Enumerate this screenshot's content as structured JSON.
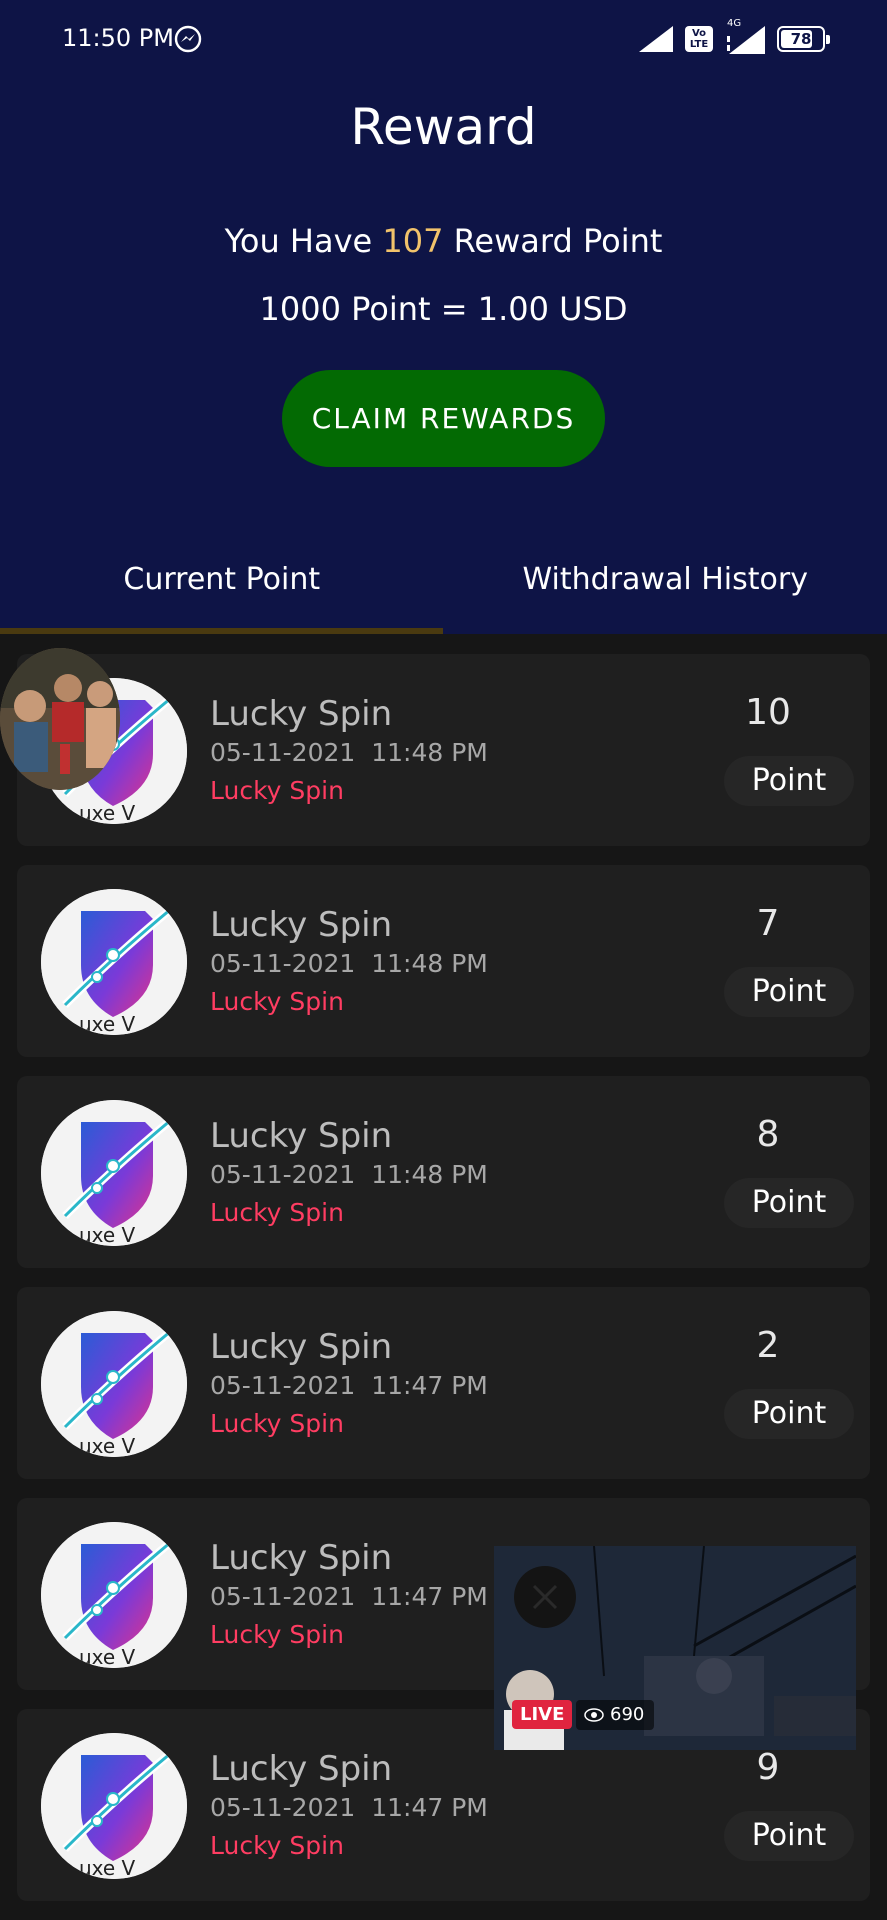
{
  "status_bar": {
    "time": "11:50 PM",
    "messenger_icon": "messenger-icon",
    "volte_label_top": "Vo",
    "volte_label_bottom": "LTE",
    "network_label": "4G",
    "battery_level": "78",
    "battery_fraction": 0.78
  },
  "header": {
    "title": "Reward",
    "points_prefix": "You Have ",
    "points_value": "107",
    "points_suffix": " Reward Point",
    "rate_text": "1000 Point = 1.00 USD",
    "claim_button_label": "CLAIM REWARDS",
    "claim_button_color": "#036a03",
    "background_color": "#0e1446"
  },
  "tabs": [
    {
      "label": "Current Point",
      "active": true
    },
    {
      "label": "Withdrawal History",
      "active": false
    }
  ],
  "rows": [
    {
      "title": "Lucky Spin",
      "date": "05-11-2021",
      "time": "11:48 PM",
      "subtitle": "Lucky Spin",
      "value": "10",
      "unit": "Point"
    },
    {
      "title": "Lucky Spin",
      "date": "05-11-2021",
      "time": "11:48 PM",
      "subtitle": "Lucky Spin",
      "value": "7",
      "unit": "Point"
    },
    {
      "title": "Lucky Spin",
      "date": "05-11-2021",
      "time": "11:48 PM",
      "subtitle": "Lucky Spin",
      "value": "8",
      "unit": "Point"
    },
    {
      "title": "Lucky Spin",
      "date": "05-11-2021",
      "time": "11:47 PM",
      "subtitle": "Lucky Spin",
      "value": "2",
      "unit": "Point"
    },
    {
      "title": "Lucky Spin",
      "date": "05-11-2021",
      "time": "11:47 PM",
      "subtitle": "Lucky Spin",
      "value": "",
      "unit": ""
    },
    {
      "title": "Lucky Spin",
      "date": "05-11-2021",
      "time": "11:47 PM",
      "subtitle": "Lucky Spin",
      "value": "9",
      "unit": "Point"
    }
  ],
  "logo_text": "uxe V",
  "live_overlay": {
    "badge": "LIVE",
    "viewers": "690",
    "close_icon": "close-icon"
  }
}
